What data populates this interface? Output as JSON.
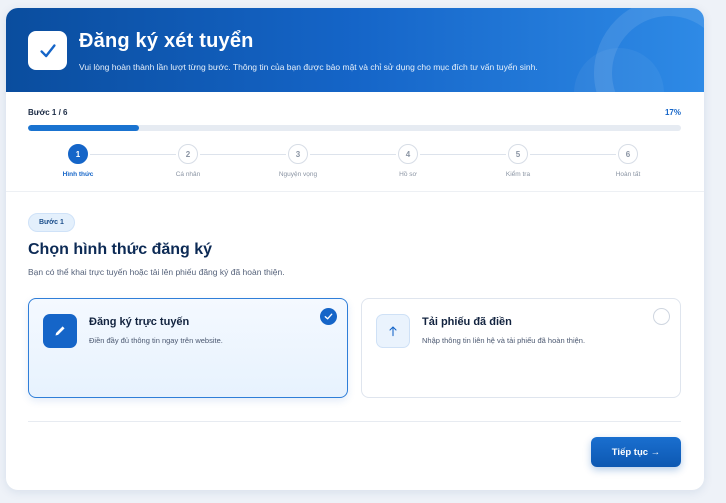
{
  "header": {
    "title": "Đăng ký xét tuyển",
    "subtitle": "Vui lòng hoàn thành lần lượt từng bước. Thông tin của bạn được bảo mật và chỉ sử dụng cho mục đích tư vấn tuyển sinh."
  },
  "progress": {
    "step_text": "Bước 1 / 6",
    "percent_text": "17%",
    "percent": 17
  },
  "steps": [
    {
      "num": "1",
      "label": "Hình thức",
      "active": true
    },
    {
      "num": "2",
      "label": "Cá nhân",
      "active": false
    },
    {
      "num": "3",
      "label": "Nguyện vọng",
      "active": false
    },
    {
      "num": "4",
      "label": "Hồ sơ",
      "active": false
    },
    {
      "num": "5",
      "label": "Kiểm tra",
      "active": false
    },
    {
      "num": "6",
      "label": "Hoàn tất",
      "active": false
    }
  ],
  "section": {
    "badge": "Bước 1",
    "title": "Chọn hình thức đăng ký",
    "description": "Bạn có thể khai trực tuyến hoặc tải lên phiếu đăng ký đã hoàn thiện."
  },
  "options": [
    {
      "title": "Đăng ký trực tuyến",
      "description": "Điền đầy đủ thông tin ngay trên website.",
      "selected": true,
      "icon": "pencil-icon"
    },
    {
      "title": "Tải phiếu đã điền",
      "description": "Nhập thông tin liên hệ và tải phiếu đã hoàn thiện.",
      "selected": false,
      "icon": "upload-arrow-icon"
    }
  ],
  "actions": {
    "next_label": "Tiếp tục →"
  },
  "colors": {
    "primary": "#1565c8",
    "header_start": "#0a4d9e",
    "header_end": "#2e8ae6"
  }
}
